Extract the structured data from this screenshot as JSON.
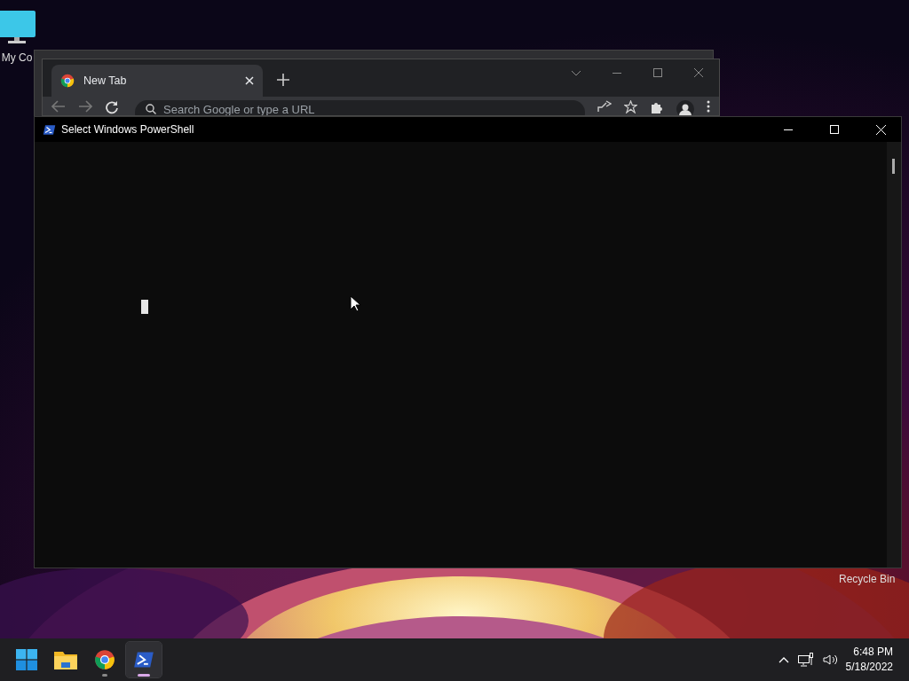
{
  "desktop_icons": [
    {
      "label": "My Co"
    },
    {
      "label": "Recycle Bin"
    }
  ],
  "browser_window": {
    "tab": {
      "title": "New Tab",
      "selected": true
    },
    "omnibox": {
      "placeholder": "Search Google or type a URL"
    }
  },
  "console_window": {
    "title": "Select Windows PowerShell"
  },
  "taskbar": {
    "apps": [
      {
        "kind": "start",
        "running": false,
        "active": false
      },
      {
        "kind": "files",
        "running": false,
        "active": false
      },
      {
        "kind": "chrome",
        "running": true,
        "active": false
      },
      {
        "kind": "powershell",
        "running": true,
        "active": true
      }
    ],
    "clock": {
      "time": "6:48 PM",
      "date": "5/18/2022"
    }
  }
}
